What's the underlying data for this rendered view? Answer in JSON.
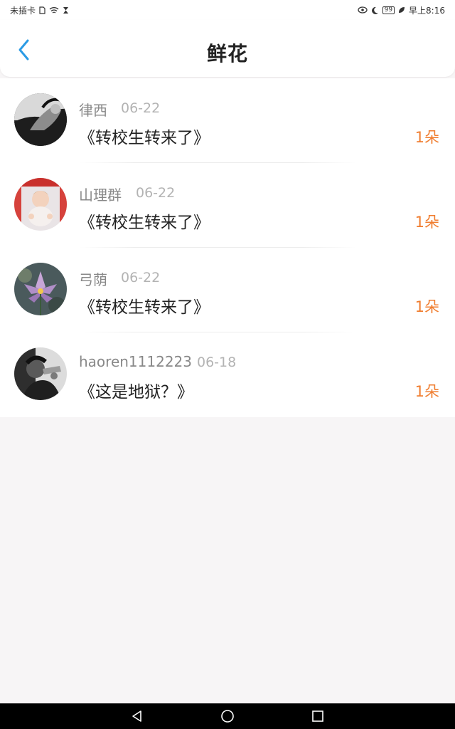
{
  "status_bar": {
    "carrier": "未插卡",
    "battery": "99",
    "time": "早上8:16"
  },
  "header": {
    "title": "鲜花",
    "back_icon": "chevron-left-icon",
    "accent": "#2b9be5"
  },
  "flower_list": [
    {
      "user": "律西",
      "date": "06-22",
      "book": "《转校生转来了》",
      "count": "1朵"
    },
    {
      "user": "山理群",
      "date": "06-22",
      "book": "《转校生转来了》",
      "count": "1朵"
    },
    {
      "user": "弓荫",
      "date": "06-22",
      "book": "《转校生转来了》",
      "count": "1朵"
    },
    {
      "user": "haoren1112223",
      "date": "06-18",
      "book": "《这是地狱？》",
      "count": "1朵"
    }
  ],
  "colors": {
    "count_accent": "#f07d2f",
    "background": "#f7f5f6"
  },
  "nav": {
    "back": "triangle-back-icon",
    "home": "circle-home-icon",
    "recents": "square-recents-icon"
  }
}
